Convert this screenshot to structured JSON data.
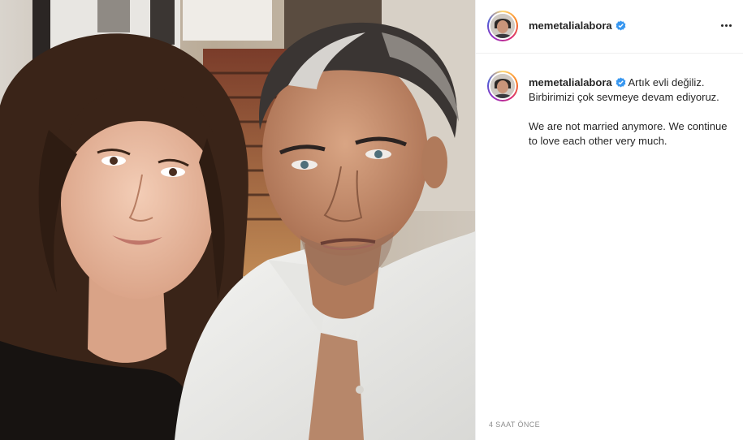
{
  "post": {
    "username": "memetalialabora",
    "verified": true,
    "more_icon": "more-horizontal-icon",
    "photo": {
      "description_icon": "selfie-photo"
    },
    "caption": {
      "username": "memetalialabora",
      "line1": "Artık evli değiliz. Birbirimizi çok sevmeye devam ediyoruz.",
      "line2": "We are not married anymore. We continue to love each other very much."
    },
    "timestamp": "4 saat önce"
  },
  "colors": {
    "verified_blue": "#3897f0",
    "text": "#262626",
    "muted": "#8e8e8e",
    "divider": "#efefef"
  }
}
